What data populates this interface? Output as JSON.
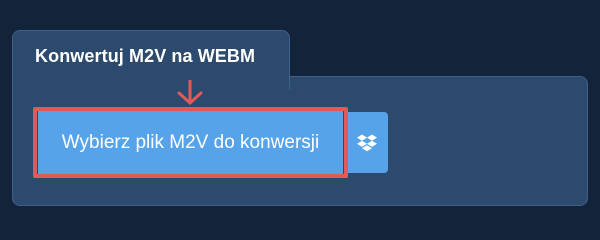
{
  "converter": {
    "tab_title": "Konwertuj M2V na WEBM",
    "choose_file_label": "Wybierz plik M2V do konwersji",
    "dropbox_icon": "dropbox-icon"
  },
  "colors": {
    "page_background": "#13233a",
    "panel_background": "#2b4a6d",
    "button": "#56a3ea",
    "highlight": "#e05a5a"
  }
}
